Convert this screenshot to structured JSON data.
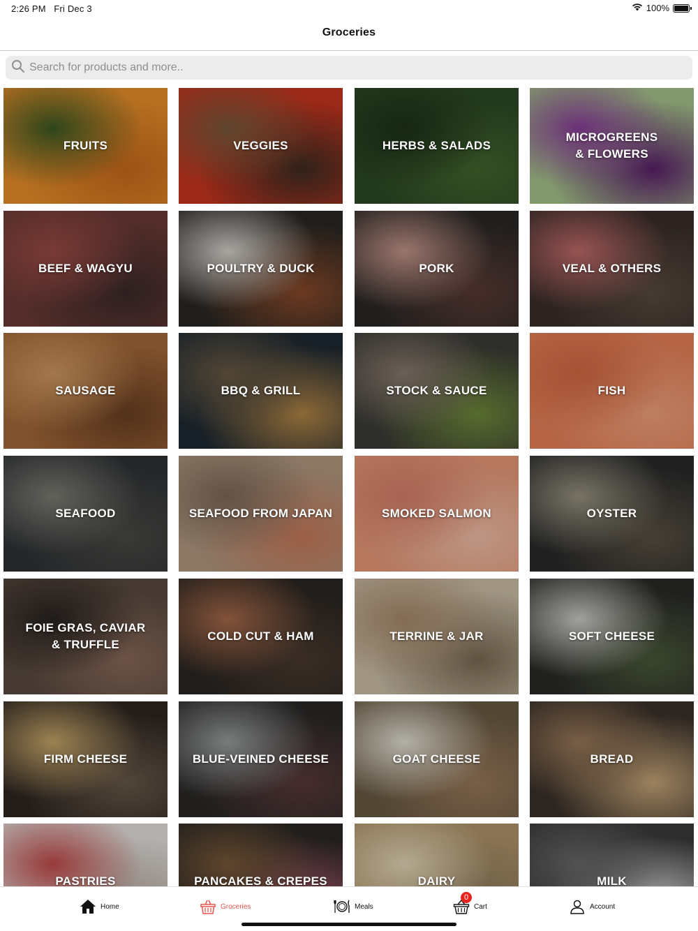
{
  "status": {
    "time": "2:26 PM",
    "date": "Fri Dec 3",
    "battery": "100%",
    "battery_level": 1.0,
    "wifi_icon": "wifi-icon",
    "battery_icon": "battery-icon"
  },
  "nav": {
    "title": "Groceries"
  },
  "search": {
    "placeholder": "Search for products and more..",
    "icon": "search-icon"
  },
  "categories": [
    {
      "label": "FRUITS",
      "bg": [
        "#e9902a",
        "#3c5a24",
        "#c96a1c"
      ]
    },
    {
      "label": "VEGGIES",
      "bg": [
        "#c9351f",
        "#7a5a3c",
        "#3d2c22"
      ]
    },
    {
      "label": "HERBS & SALADS",
      "bg": [
        "#2d4a26",
        "#1e3319",
        "#44662e"
      ]
    },
    {
      "label": "MICROGREENS\n& FLOWERS",
      "bg": [
        "#a7c48c",
        "#8a3d9a",
        "#5b1f6b"
      ]
    },
    {
      "label": "BEEF & WAGYU",
      "bg": [
        "#6a3a36",
        "#9b4a45",
        "#3c2a2a"
      ]
    },
    {
      "label": "POULTRY & DUCK",
      "bg": [
        "#2a2724",
        "#d9d5cf",
        "#8a4a2a"
      ]
    },
    {
      "label": "PORK",
      "bg": [
        "#2b2826",
        "#c7978c",
        "#5a3b35"
      ]
    },
    {
      "label": "VEAL & OTHERS",
      "bg": [
        "#3a2e2a",
        "#c26b6b",
        "#5a4b40"
      ]
    },
    {
      "label": "SAUSAGE",
      "bg": [
        "#a56a3a",
        "#d19a62",
        "#6a3f22"
      ]
    },
    {
      "label": "BBQ & GRILL",
      "bg": [
        "#1f2a33",
        "#6a5a44",
        "#b48646"
      ]
    },
    {
      "label": "STOCK & SAUCE",
      "bg": [
        "#3a3a36",
        "#8a7a6e",
        "#6f8a3a"
      ]
    },
    {
      "label": "FISH",
      "bg": [
        "#e8825a",
        "#d46a44",
        "#f3a27c"
      ]
    },
    {
      "label": "SEAFOOD",
      "bg": [
        "#2f3236",
        "#7e7d74",
        "#4a4a44"
      ]
    },
    {
      "label": "SEAFOOD FROM JAPAN",
      "bg": [
        "#b39a82",
        "#7e6a5a",
        "#c97a5a"
      ]
    },
    {
      "label": "SMOKED SALMON",
      "bg": [
        "#e89a7a",
        "#d8806a",
        "#f2c0a8"
      ]
    },
    {
      "label": "OYSTER",
      "bg": [
        "#2a2a2a",
        "#9a9482",
        "#5a5244"
      ]
    },
    {
      "label": "FOIE GRAS, CAVIAR\n& TRUFFLE",
      "bg": [
        "#5a4a40",
        "#2a2420",
        "#8a6a5a"
      ]
    },
    {
      "label": "COLD CUT & HAM",
      "bg": [
        "#2b2622",
        "#a86a4a",
        "#4a3a30"
      ]
    },
    {
      "label": "TERRINE & JAR",
      "bg": [
        "#cdbfa8",
        "#a88a6a",
        "#7a6a54"
      ]
    },
    {
      "label": "SOFT CHEESE",
      "bg": [
        "#2a2a28",
        "#cfcfc8",
        "#4a5a3a"
      ]
    },
    {
      "label": "FIRM CHEESE",
      "bg": [
        "#2e2622",
        "#c9a86a",
        "#6a5a4a"
      ]
    },
    {
      "label": "BLUE-VEINED CHEESE",
      "bg": [
        "#2a2826",
        "#9aa0a0",
        "#5a3a3a"
      ]
    },
    {
      "label": "GOAT CHEESE",
      "bg": [
        "#6a5a44",
        "#e6e2d6",
        "#9a7a5a"
      ]
    },
    {
      "label": "BREAD",
      "bg": [
        "#3a302a",
        "#9a7a5a",
        "#c9a87a"
      ]
    },
    {
      "label": "PASTRIES",
      "bg": [
        "#e6e2de",
        "#c24a4a",
        "#b6aaa0"
      ]
    },
    {
      "label": "PANCAKES & CREPES",
      "bg": [
        "#2a2624",
        "#7a5a3a",
        "#a85a6a"
      ]
    },
    {
      "label": "DAIRY",
      "bg": [
        "#b0946a",
        "#e6d8b8",
        "#8a7a5a"
      ]
    },
    {
      "label": "MILK",
      "bg": [
        "#3a3a3a",
        "#6a6a6a",
        "#dcdcdc"
      ]
    }
  ],
  "tabs": [
    {
      "label": "Home",
      "icon": "home-icon"
    },
    {
      "label": "Groceries",
      "icon": "groceries-basket-icon",
      "active": true
    },
    {
      "label": "Meals",
      "icon": "meals-plate-icon"
    },
    {
      "label": "Cart",
      "icon": "cart-basket-icon",
      "badge": "0"
    },
    {
      "label": "Account",
      "icon": "account-icon"
    }
  ],
  "colors": {
    "accent": "#e8534a",
    "badge": "#e8231f",
    "search_bg": "#ececec"
  }
}
